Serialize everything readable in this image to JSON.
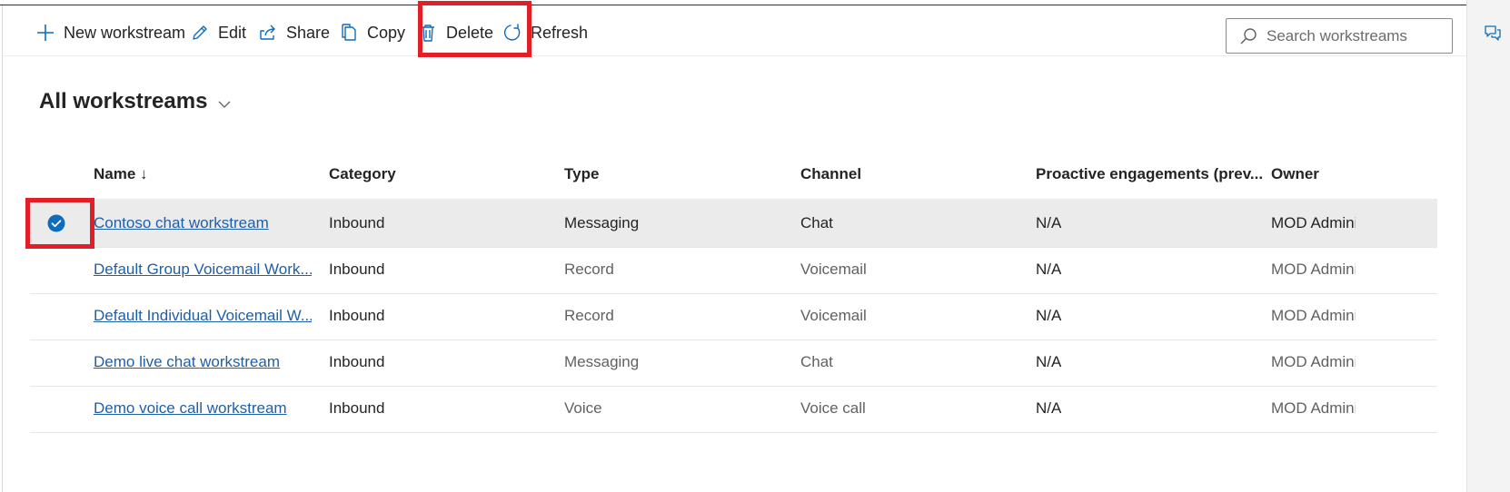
{
  "toolbar": {
    "new_label": "New workstream",
    "edit_label": "Edit",
    "share_label": "Share",
    "copy_label": "Copy",
    "delete_label": "Delete",
    "refresh_label": "Refresh"
  },
  "search": {
    "placeholder": "Search workstreams"
  },
  "view": {
    "title": "All workstreams"
  },
  "columns": {
    "name": "Name ↓",
    "category": "Category",
    "type": "Type",
    "channel": "Channel",
    "proactive": "Proactive engagements (prev...",
    "owner": "Owner"
  },
  "rows": [
    {
      "name": "Contoso chat workstream",
      "category": "Inbound",
      "type": "Messaging",
      "channel": "Chat",
      "proactive": "N/A",
      "owner": "MOD Admini",
      "selected": true
    },
    {
      "name": "Default Group Voicemail Work...",
      "category": "Inbound",
      "type": "Record",
      "channel": "Voicemail",
      "proactive": "N/A",
      "owner": "MOD Admini",
      "selected": false
    },
    {
      "name": "Default Individual Voicemail W...",
      "category": "Inbound",
      "type": "Record",
      "channel": "Voicemail",
      "proactive": "N/A",
      "owner": "MOD Admini",
      "selected": false
    },
    {
      "name": "Demo live chat workstream",
      "category": "Inbound",
      "type": "Messaging",
      "channel": "Chat",
      "proactive": "N/A",
      "owner": "MOD Admini",
      "selected": false
    },
    {
      "name": "Demo voice call workstream",
      "category": "Inbound",
      "type": "Voice",
      "channel": "Voice call",
      "proactive": "N/A",
      "owner": "MOD Admini",
      "selected": false
    }
  ],
  "icons": {
    "new": "plus-icon",
    "edit": "pencil-icon",
    "share": "share-icon",
    "copy": "copy-icon",
    "delete": "trash-icon",
    "refresh": "refresh-icon",
    "search": "search-icon",
    "view_menu": "chevron-down-icon",
    "select": "checkmark-circle-icon",
    "side_panel": "chat-bubbles-icon"
  },
  "colors": {
    "accent": "#0f6cbd",
    "link": "#1f5fa8",
    "highlight": "#e21f26",
    "selected_row": "#ebebeb"
  }
}
